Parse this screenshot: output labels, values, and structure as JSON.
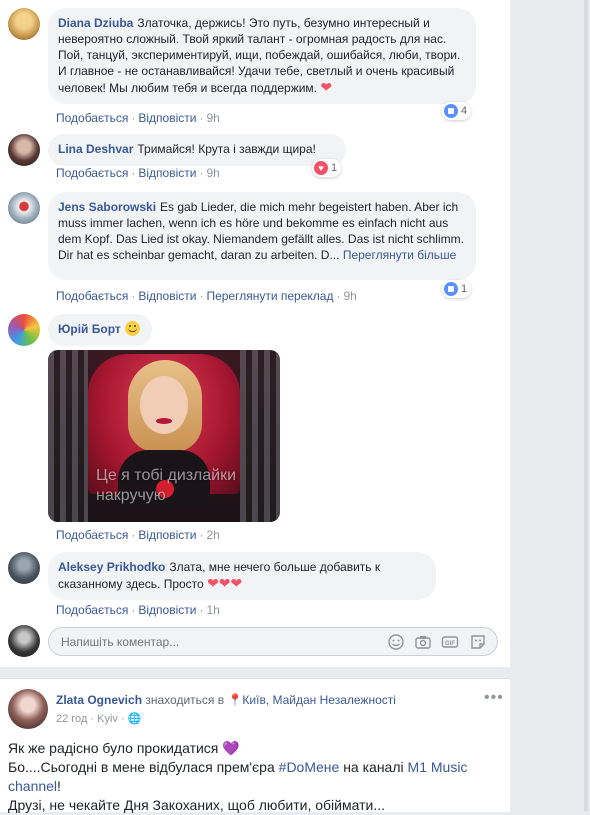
{
  "comments": [
    {
      "author": "Diana Dziuba",
      "text": "Златочка, держись! Это путь, безумно интересный и невероятно сложный. Твой яркий талант - огромная радость для нас. Пой, танцуй, экспериментируй, ищи, побеждай, ошибайся, люби, твори. И главное - не останавливайся! Удачи тебе, светлый и очень красивый человек! Мы любим тебя и всегда поддержим.",
      "like": "Подобається",
      "reply": "Відповісти",
      "time": "9h",
      "reactions": "4"
    },
    {
      "author": "Lina Deshvar",
      "text": "Тримайся! Крута і завжди щира!",
      "like": "Подобається",
      "reply": "Відповісти",
      "time": "9h",
      "reactions": "1"
    },
    {
      "author": "Jens Saborowski",
      "text": "Es gab Lieder, die mich mehr begeistert haben. Aber ich muss immer lachen, wenn ich es höre und bekomme es einfach nicht aus dem Kopf. Das Lied ist okay. Niemandem gefällt alles. Das ist nicht schlimm. Dir hat es scheinbar gemacht, daran zu arbeiten. D...",
      "see_more": "Переглянути більше",
      "like": "Подобається",
      "reply": "Відповісти",
      "translate": "Переглянути переклад",
      "time": "9h",
      "reactions": "1"
    },
    {
      "author": "Юрій Борт",
      "meme_caption_line1": "Це я тобі дизлайки",
      "meme_caption_line2": "накручую",
      "like": "Подобається",
      "reply": "Відповісти",
      "time": "2h"
    },
    {
      "author": "Aleksey Prikhodko",
      "text": "Злата, мне нечего больше добавить к сказанному здесь. Просто",
      "like": "Подобається",
      "reply": "Відповісти",
      "time": "1h"
    }
  ],
  "reply_box": {
    "placeholder": "Напишіть коментар..."
  },
  "post": {
    "author": "Zlata Ognevich",
    "location_prefix": "знаходиться в",
    "location": "Київ, Майдан Незалежності",
    "time": "22 год",
    "place_short": "Kyiv",
    "line1": "Як же радісно було прокидатися",
    "line2_prefix": "Бо....Сьогодні в мене відбулася прем'єра",
    "hashtag": "#DoMене",
    "line2_mid": "на каналі",
    "channel": "M1 Music channel",
    "line2_end": "!",
    "line3": "Друзі, не чекайте Дня Закоханих, щоб любити, обіймати..."
  },
  "colors": {
    "link": "#385898",
    "bubble": "#f2f3f5",
    "love": "#f25268",
    "like": "#5890ff"
  }
}
